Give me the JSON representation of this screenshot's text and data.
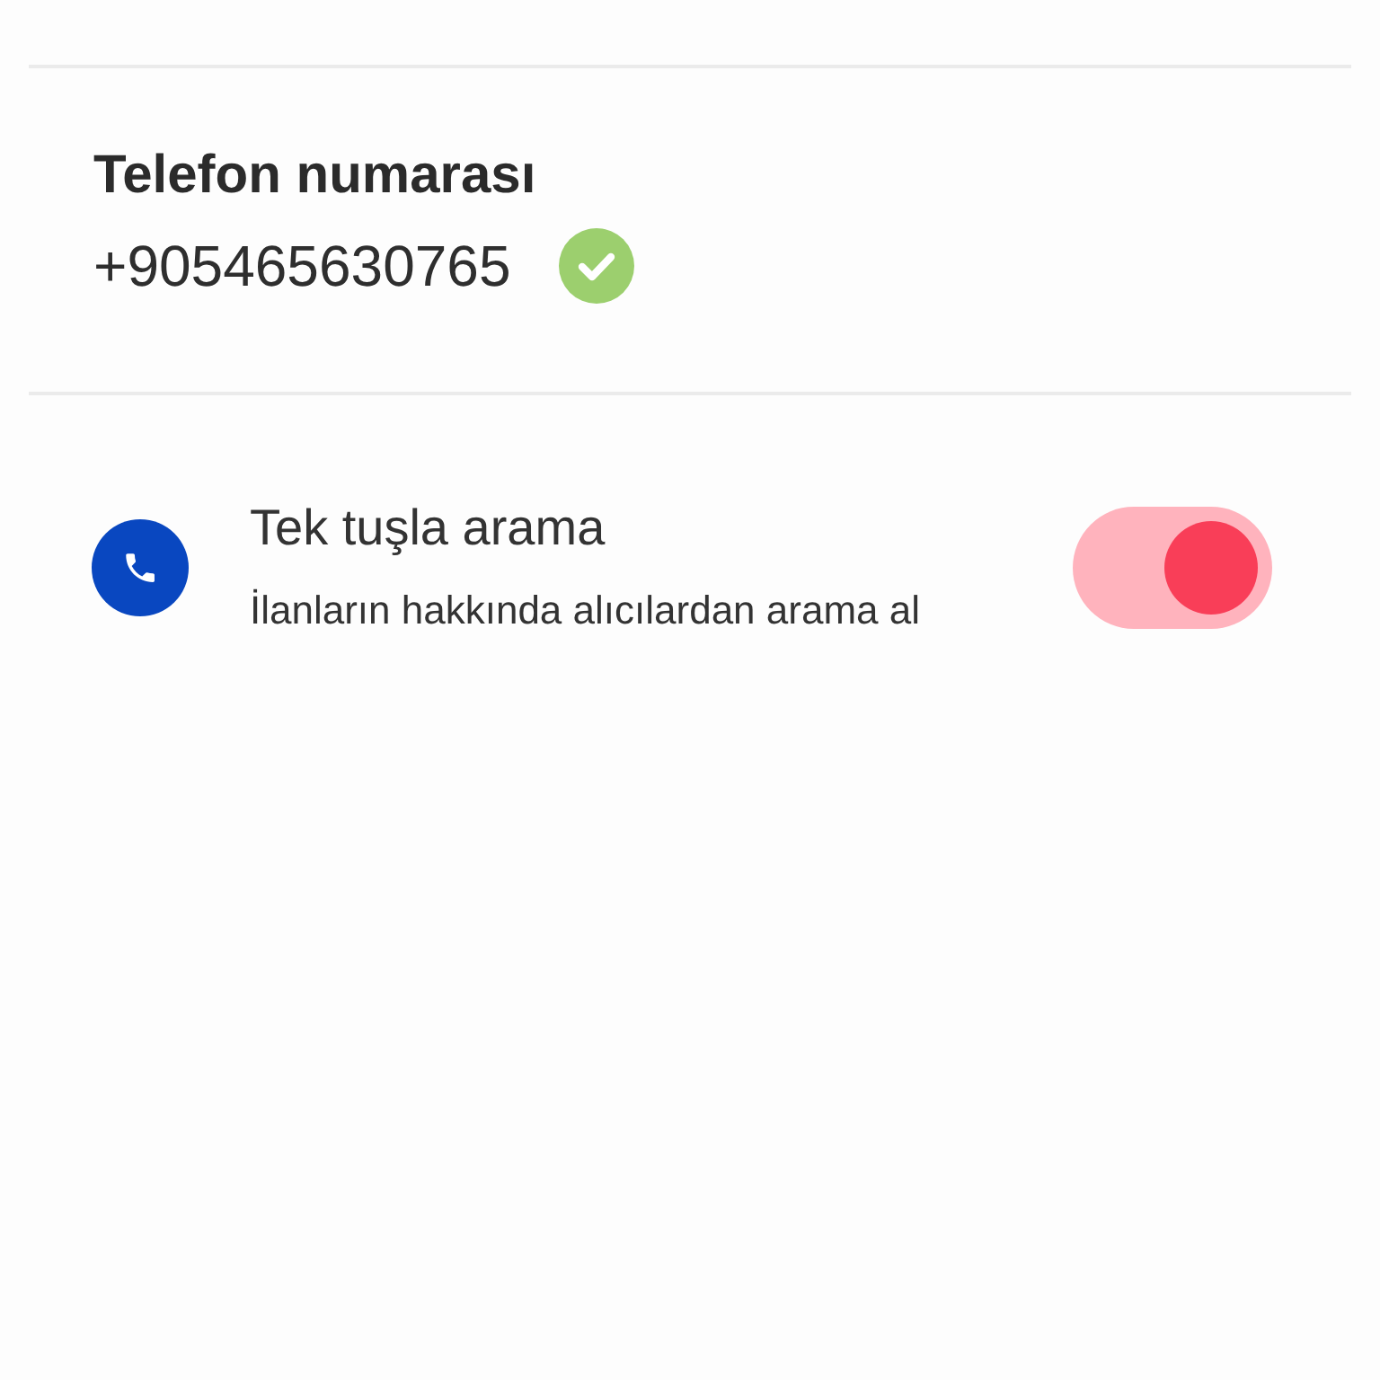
{
  "phone": {
    "label": "Telefon numarası",
    "number": "+905465630765",
    "verified": true
  },
  "settings": [
    {
      "title": "Tek tuşla arama",
      "description": "İlanların hakkında alıcılardan arama al",
      "on": true
    }
  ]
}
